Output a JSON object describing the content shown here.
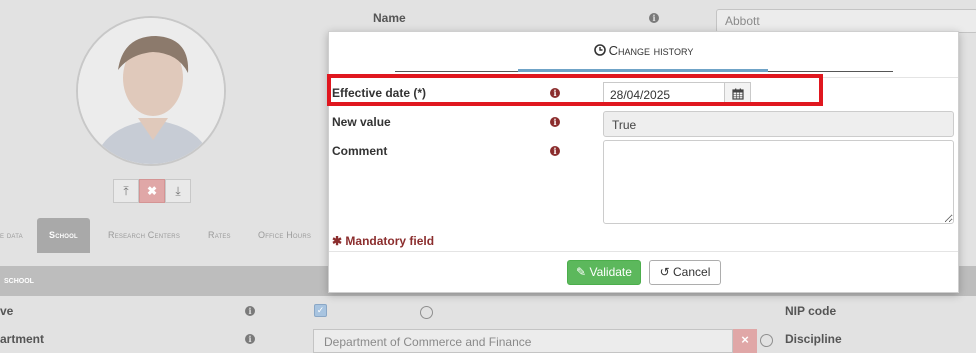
{
  "background": {
    "name_label": "Name",
    "name_value": "Abbott",
    "photo_buttons": {
      "upload": "⤒",
      "delete": "✖",
      "download": "⤓"
    },
    "tabs": [
      {
        "label": "e data",
        "active": false
      },
      {
        "label": "School",
        "active": true
      },
      {
        "label": "Research Centers",
        "active": false
      },
      {
        "label": "Rates",
        "active": false
      },
      {
        "label": "Office Hours",
        "active": false
      }
    ],
    "section_title": "school",
    "row_active_label": "ve",
    "row_department_label": "artment",
    "department_value": "Department of Commerce and Finance",
    "nip_code_label": "NIP code",
    "discipline_label": "Discipline"
  },
  "modal": {
    "title": "Change history",
    "fields": {
      "effective_date_label": "Effective date (*)",
      "effective_date_value": "28/04/2025",
      "new_value_label": "New value",
      "new_value_value": "True",
      "comment_label": "Comment",
      "comment_value": ""
    },
    "mandatory_note": "Mandatory field",
    "validate_label": "Validate",
    "cancel_label": "Cancel"
  },
  "colors": {
    "validate": "#5cb85c",
    "info_red": "#8b2d2d",
    "highlight": "#e0171f",
    "accent_line": "#6fa3c7"
  }
}
